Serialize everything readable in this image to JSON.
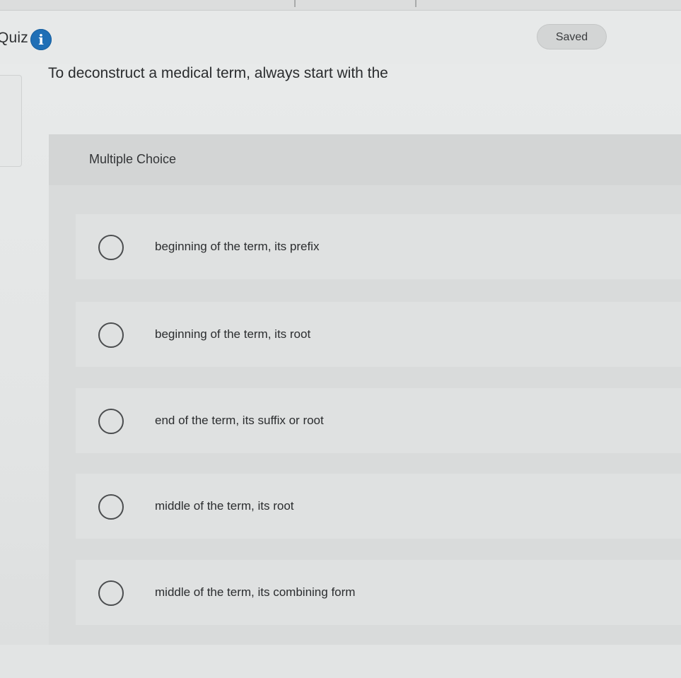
{
  "header": {
    "title": "Quiz",
    "info_icon": "info-icon",
    "saved_label": "Saved"
  },
  "question": {
    "text": "To deconstruct a medical term, always start with the"
  },
  "multiple_choice": {
    "label": "Multiple Choice",
    "options": [
      {
        "label": "beginning of the term, its prefix",
        "selected": false
      },
      {
        "label": "beginning of the term, its root",
        "selected": false
      },
      {
        "label": "end of the term, its suffix or root",
        "selected": false
      },
      {
        "label": "middle of the term, its root",
        "selected": false
      },
      {
        "label": "middle of the term, its combining form",
        "selected": false
      }
    ]
  },
  "colors": {
    "accent": "#1f6fb6",
    "background": "#e6e8e8",
    "panel": "#d9dbdb"
  }
}
